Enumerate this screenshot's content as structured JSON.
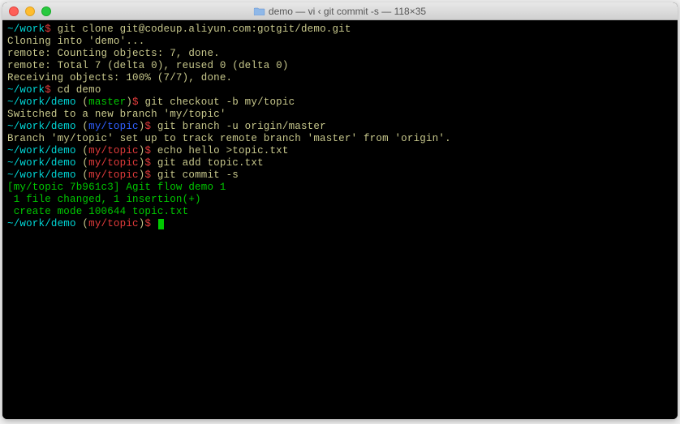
{
  "window": {
    "title": "demo — vi ‹ git commit -s — 118×35"
  },
  "lines": [
    [
      {
        "cls": "cyan",
        "t": "~/work"
      },
      {
        "cls": "red",
        "t": "$"
      },
      {
        "cls": "buff",
        "t": " git clone git@codeup.aliyun.com:gotgit/demo.git"
      }
    ],
    [
      {
        "cls": "buff",
        "t": "Cloning into 'demo'..."
      }
    ],
    [
      {
        "cls": "buff",
        "t": "remote: Counting objects: 7, done."
      }
    ],
    [
      {
        "cls": "buff",
        "t": "remote: Total 7 (delta 0), reused 0 (delta 0)"
      }
    ],
    [
      {
        "cls": "buff",
        "t": "Receiving objects: 100% (7/7), done."
      }
    ],
    [
      {
        "cls": "cyan",
        "t": "~/work"
      },
      {
        "cls": "red",
        "t": "$"
      },
      {
        "cls": "buff",
        "t": " cd demo"
      }
    ],
    [
      {
        "cls": "cyan",
        "t": "~/work/demo"
      },
      {
        "cls": "buff",
        "t": " ("
      },
      {
        "cls": "green",
        "t": "master"
      },
      {
        "cls": "buff",
        "t": ")"
      },
      {
        "cls": "red",
        "t": "$"
      },
      {
        "cls": "buff",
        "t": " git checkout -b my/topic"
      }
    ],
    [
      {
        "cls": "buff",
        "t": "Switched to a new branch 'my/topic'"
      }
    ],
    [
      {
        "cls": "cyan",
        "t": "~/work/demo"
      },
      {
        "cls": "buff",
        "t": " ("
      },
      {
        "cls": "blue",
        "t": "my/topic"
      },
      {
        "cls": "buff",
        "t": ")"
      },
      {
        "cls": "red",
        "t": "$"
      },
      {
        "cls": "buff",
        "t": " git branch -u origin/master"
      }
    ],
    [
      {
        "cls": "buff",
        "t": "Branch 'my/topic' set up to track remote branch 'master' from 'origin'."
      }
    ],
    [
      {
        "cls": "cyan",
        "t": "~/work/demo"
      },
      {
        "cls": "buff",
        "t": " ("
      },
      {
        "cls": "red",
        "t": "my/topic"
      },
      {
        "cls": "buff",
        "t": ")"
      },
      {
        "cls": "red",
        "t": "$"
      },
      {
        "cls": "buff",
        "t": " echo hello >topic.txt"
      }
    ],
    [
      {
        "cls": "cyan",
        "t": "~/work/demo"
      },
      {
        "cls": "buff",
        "t": " ("
      },
      {
        "cls": "red",
        "t": "my/topic"
      },
      {
        "cls": "buff",
        "t": ")"
      },
      {
        "cls": "red",
        "t": "$"
      },
      {
        "cls": "buff",
        "t": " git add topic.txt"
      }
    ],
    [
      {
        "cls": "cyan",
        "t": "~/work/demo"
      },
      {
        "cls": "buff",
        "t": " ("
      },
      {
        "cls": "red",
        "t": "my/topic"
      },
      {
        "cls": "buff",
        "t": ")"
      },
      {
        "cls": "red",
        "t": "$"
      },
      {
        "cls": "buff",
        "t": " git commit -s"
      }
    ],
    [
      {
        "cls": "green",
        "t": "[my/topic 7b961c3] Agit flow demo 1"
      }
    ],
    [
      {
        "cls": "green",
        "t": " 1 file changed, 1 insertion(+)"
      }
    ],
    [
      {
        "cls": "green",
        "t": " create mode 100644 topic.txt"
      }
    ],
    [
      {
        "cls": "cyan",
        "t": "~/work/demo"
      },
      {
        "cls": "buff",
        "t": " ("
      },
      {
        "cls": "red",
        "t": "my/topic"
      },
      {
        "cls": "buff",
        "t": ")"
      },
      {
        "cls": "red",
        "t": "$"
      },
      {
        "cls": "buff",
        "t": " "
      }
    ]
  ]
}
